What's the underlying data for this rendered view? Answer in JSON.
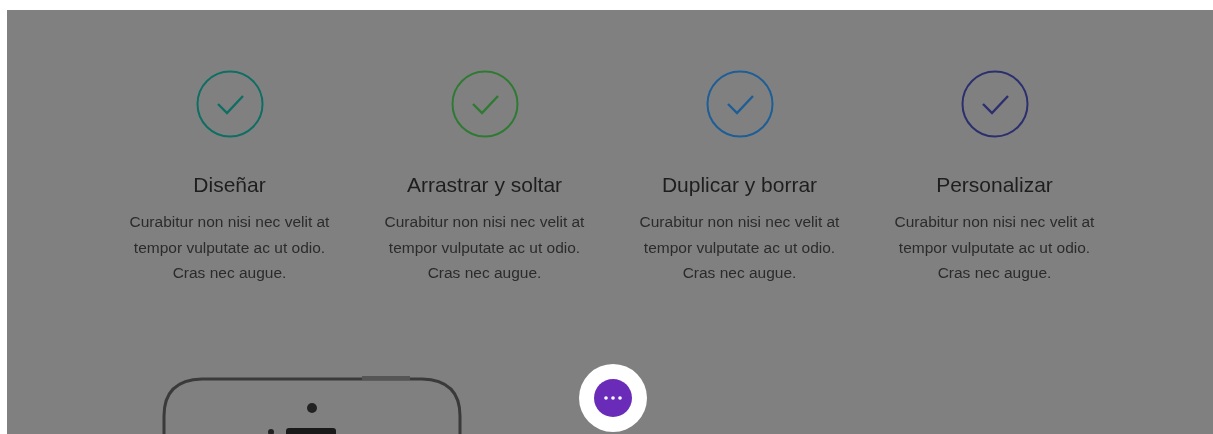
{
  "features": [
    {
      "title": "Diseñar",
      "description": "Curabitur non nisi nec velit at tempor vulputate ac ut odio. Cras nec augue.",
      "color": "#0f6e63"
    },
    {
      "title": "Arrastrar y soltar",
      "description": "Curabitur non nisi nec velit at tempor vulputate ac ut odio. Cras nec augue.",
      "color": "#2f7a33"
    },
    {
      "title": "Duplicar y borrar",
      "description": "Curabitur non nisi nec velit at tempor vulputate ac ut odio. Cras nec augue.",
      "color": "#1d5e96"
    },
    {
      "title": "Personalizar",
      "description": "Curabitur non nisi nec velit at tempor vulputate ac ut odio. Cras nec augue.",
      "color": "#2c2f6e"
    }
  ]
}
